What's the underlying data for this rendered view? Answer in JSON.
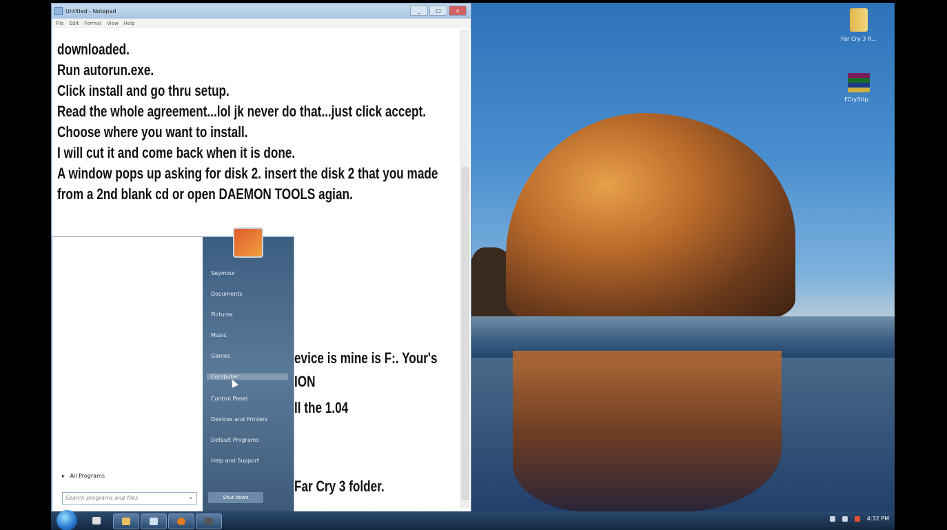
{
  "notepad": {
    "title": "Untitled - Notepad",
    "menu": [
      "File",
      "Edit",
      "Format",
      "View",
      "Help"
    ],
    "controls": [
      "_",
      "□",
      "x"
    ],
    "lines": [
      "downloaded.",
      "Run autorun.exe.",
      "Click install and go thru setup.",
      "Read the whole agreement...lol jk never do that...just click accept.",
      "Choose where you want to install.",
      "I will cut it and come back when it is done.",
      "A window pops up asking for disk 2. insert the disk 2 that you made",
      "from a 2nd blank cd or open DAEMON TOOLS agian."
    ],
    "partial_lines": [
      "evice is mine is F:. Your's",
      "ION",
      "ll the 1.04",
      "Far Cry 3 folder."
    ]
  },
  "start_menu": {
    "right_items": [
      "Seymour",
      "Documents",
      "Pictures",
      "Music",
      "Games",
      "Computer",
      "Control Panel",
      "Devices and Printers",
      "Default Programs",
      "Help and Support"
    ],
    "all_programs": "All Programs",
    "search_placeholder": "Search programs and files",
    "search_icon": "⌕",
    "shutdown_label": "Shut down",
    "arrow": "▸"
  },
  "desktop": {
    "icons": [
      {
        "label": "Far Cry 3 R...",
        "icon": "folder-icon"
      },
      {
        "label": "FCry3Up...",
        "icon": "winrar-archive-icon"
      }
    ]
  },
  "taskbar": {
    "clock": "4:32 PM",
    "tray_icons": [
      "flag-icon",
      "network-icon",
      "volume-icon"
    ]
  }
}
